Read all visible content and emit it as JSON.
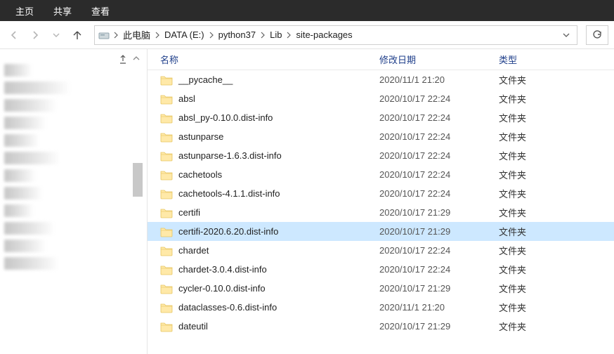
{
  "ribbon": {
    "tabs": [
      "主页",
      "共享",
      "查看"
    ]
  },
  "breadcrumb": {
    "items": [
      "此电脑",
      "DATA (E:)",
      "python37",
      "Lib",
      "site-packages"
    ]
  },
  "columns": {
    "name": "名称",
    "date": "修改日期",
    "type": "类型"
  },
  "type_label": "文件夹",
  "files": [
    {
      "name": "__pycache__",
      "date": "2020/11/1 21:20",
      "selected": false
    },
    {
      "name": "absl",
      "date": "2020/10/17 22:24",
      "selected": false
    },
    {
      "name": "absl_py-0.10.0.dist-info",
      "date": "2020/10/17 22:24",
      "selected": false
    },
    {
      "name": "astunparse",
      "date": "2020/10/17 22:24",
      "selected": false
    },
    {
      "name": "astunparse-1.6.3.dist-info",
      "date": "2020/10/17 22:24",
      "selected": false
    },
    {
      "name": "cachetools",
      "date": "2020/10/17 22:24",
      "selected": false
    },
    {
      "name": "cachetools-4.1.1.dist-info",
      "date": "2020/10/17 22:24",
      "selected": false
    },
    {
      "name": "certifi",
      "date": "2020/10/17 21:29",
      "selected": false
    },
    {
      "name": "certifi-2020.6.20.dist-info",
      "date": "2020/10/17 21:29",
      "selected": true
    },
    {
      "name": "chardet",
      "date": "2020/10/17 22:24",
      "selected": false
    },
    {
      "name": "chardet-3.0.4.dist-info",
      "date": "2020/10/17 22:24",
      "selected": false
    },
    {
      "name": "cycler-0.10.0.dist-info",
      "date": "2020/10/17 21:29",
      "selected": false
    },
    {
      "name": "dataclasses-0.6.dist-info",
      "date": "2020/11/1 21:20",
      "selected": false
    },
    {
      "name": "dateutil",
      "date": "2020/10/17 21:29",
      "selected": false
    }
  ]
}
